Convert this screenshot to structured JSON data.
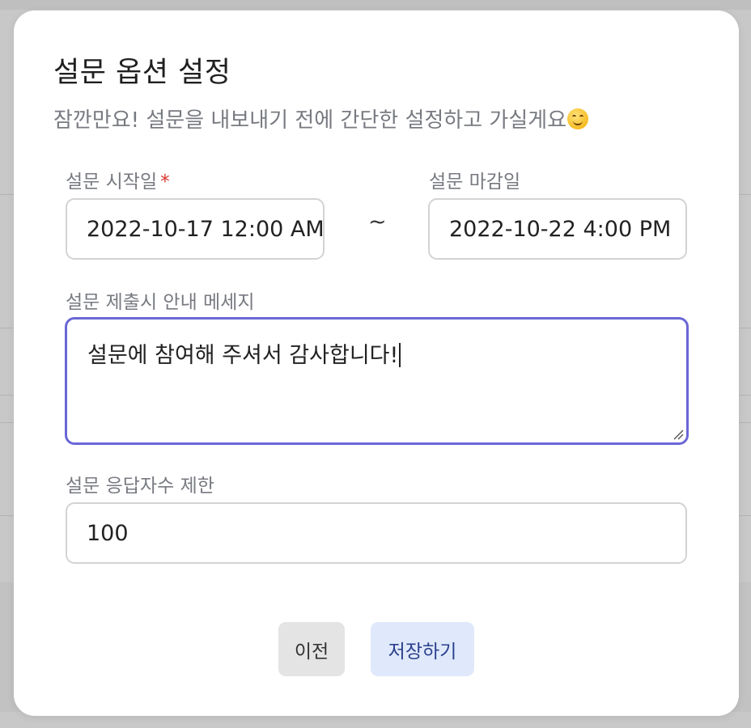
{
  "modal": {
    "title": "설문 옵션 설정",
    "subtitle": "잠깐만요! 설문을 내보내기 전에 간단한 설정하고 가실게요"
  },
  "form": {
    "start_label": "설문 시작일",
    "required_mark": "*",
    "start_value": "2022-10-17 12:00 AM",
    "range_separator": "~",
    "end_label": "설문 마감일",
    "end_value": "2022-10-22 4:00 PM",
    "message_label": "설문 제출시 안내 메세지",
    "message_value": "설문에 참여해 주셔서 감사합니다!",
    "limit_label": "설문 응답자수 제한",
    "limit_value": "100"
  },
  "buttons": {
    "prev_label": "이전",
    "save_label": "저장하기"
  },
  "icons": {
    "subtitle_emoji": "smiling-face-icon",
    "textarea_resize": "resize-handle-icon"
  },
  "colors": {
    "focus_border": "#6a67d6",
    "required": "#d9342b",
    "save_button_bg": "#dfe9fb",
    "save_button_text": "#2b3f8c",
    "prev_button_bg": "#e4e4e4"
  }
}
